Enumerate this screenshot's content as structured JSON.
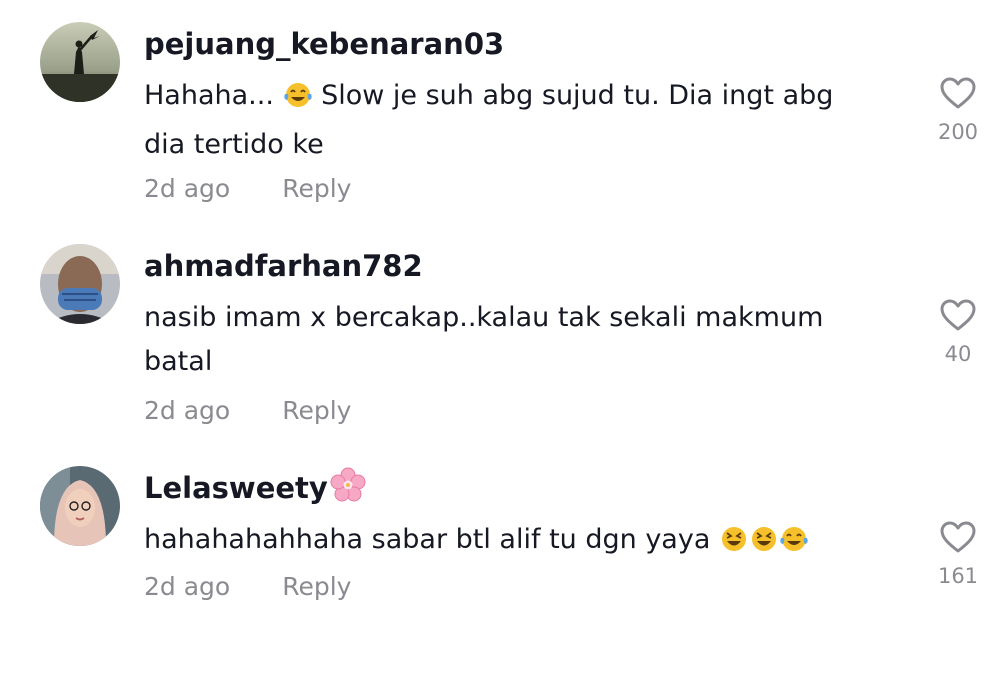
{
  "comments": [
    {
      "username": "pejuang_kebenaran03",
      "text_before": "Hahaha... ",
      "text_after": " Slow je suh abg sujud tu. Dia ingt abg dia tertido ke",
      "time": "2d ago",
      "reply_label": "Reply",
      "like_count": "200"
    },
    {
      "username": "ahmadfarhan782",
      "text": "nasib imam x bercakap..kalau tak sekali makmum batal",
      "time": "2d ago",
      "reply_label": "Reply",
      "like_count": "40"
    },
    {
      "username": "Lelasweety",
      "text": "hahahahahhaha sabar btl alif tu dgn yaya ",
      "time": "2d ago",
      "reply_label": "Reply",
      "like_count": "161"
    }
  ],
  "icons": {
    "like": "heart-outline-icon",
    "username_decoration": "cherry-blossom-emoji",
    "laugh": "face-with-tears-of-joy-emoji",
    "grin": "grinning-squinting-face-emoji"
  },
  "colors": {
    "text_primary": "#161823",
    "text_secondary": "#8a8b91",
    "background": "#ffffff"
  }
}
